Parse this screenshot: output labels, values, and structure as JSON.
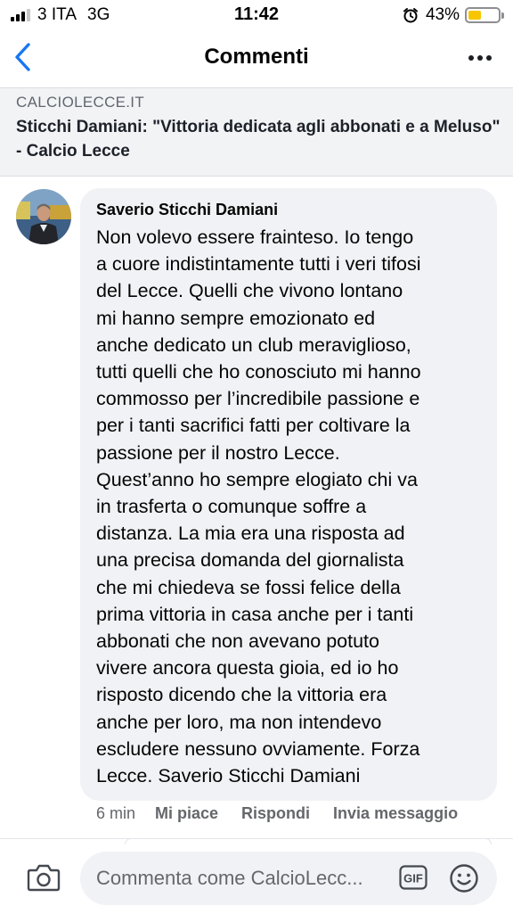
{
  "status_bar": {
    "carrier": "3 ITA",
    "network": "3G",
    "time": "11:42",
    "battery": "43%",
    "battery_level": 0.43,
    "signal_bars": 3
  },
  "nav": {
    "title": "Commenti",
    "back_icon": "chevron-left-icon",
    "more_icon": "more-dots-icon",
    "accent_color": "#1877f2"
  },
  "link_preview": {
    "domain": "CALCIOLECCE.IT",
    "title": "Sticchi Damiani: \"Vittoria dedicata agli abbonati e a Meluso\" - Calcio Lecce"
  },
  "comment": {
    "author": "Saverio Sticchi Damiani",
    "text": "Non volevo essere frainteso. Io tengo\na cuore indistintamente tutti i veri tifosi\ndel Lecce. Quelli che vivono lontano\nmi hanno sempre emozionato ed\nanche dedicato un club meraviglioso,\ntutti quelli che ho conosciuto mi hanno\ncommosso per l’incredibile passione e\nper i tanti sacrifici fatti per coltivare la\npassione per il nostro Lecce.\nQuest’anno ho sempre elogiato chi va\nin trasferta o comunque soffre a\ndistanza. La mia era una risposta ad\nuna precisa domanda del giornalista\nche mi chiedeva se fossi felice della\nprima vittoria in casa anche per i tanti\nabbonati che non avevano potuto\nvivere ancora questa gioia, ed io ho\nrisposto dicendo che la vittoria era\nanche per loro, ma non intendevo\nescludere nessuno ovviamente. Forza\nLecce. Saverio Sticchi Damiani",
    "time": "6 min",
    "like_label": "Mi piace",
    "reply_label": "Rispondi",
    "message_label": "Invia messaggio"
  },
  "composer": {
    "placeholder": "Commenta come CalcioLecc...",
    "gif_label": "GIF",
    "camera_icon": "camera-icon",
    "emoji_icon": "emoji-icon"
  }
}
